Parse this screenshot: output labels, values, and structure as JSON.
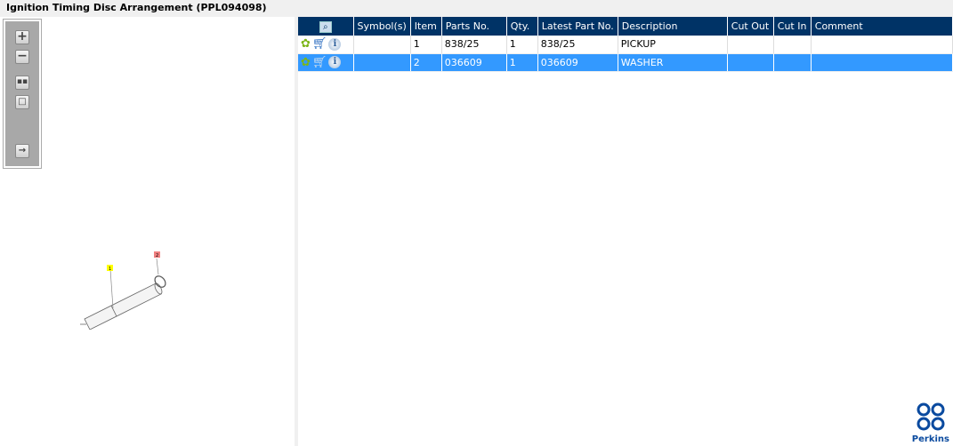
{
  "title": "Ignition Timing Disc Arrangement (PPL094098)",
  "toolbar": {
    "zoom_in": "zoom-in-icon",
    "zoom_out": "zoom-out-icon",
    "fit": "fit-icon",
    "window": "window-icon",
    "export": "export-icon"
  },
  "diagram": {
    "callouts": [
      "1",
      "2"
    ],
    "colors": {
      "callout1": "#ffff00",
      "callout2": "#f08080"
    }
  },
  "table": {
    "headers": [
      "",
      "Symbol(s)",
      "Item",
      "Parts No.",
      "Qty.",
      "Latest Part No.",
      "Description",
      "Cut Out",
      "Cut In",
      "Comment"
    ],
    "rows": [
      {
        "symbols": "",
        "item": "1",
        "parts_no": "838/25",
        "qty": "1",
        "latest": "838/25",
        "description": "PICKUP",
        "cut_out": "",
        "cut_in": "",
        "comment": ""
      },
      {
        "symbols": "",
        "item": "2",
        "parts_no": "036609",
        "qty": "1",
        "latest": "036609",
        "description": "WASHER",
        "cut_out": "",
        "cut_in": "",
        "comment": ""
      }
    ]
  },
  "logo": {
    "text": "Perkins"
  },
  "colors": {
    "header": "#003366",
    "selected": "#3399ff"
  }
}
